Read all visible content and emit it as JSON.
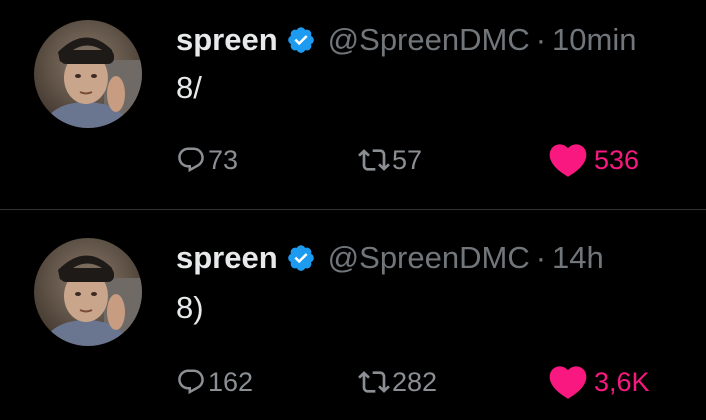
{
  "colors": {
    "background": "#000000",
    "text": "#e7e9ea",
    "muted": "#71767b",
    "verified": "#1d9bf0",
    "like": "#f91880",
    "divider": "#2f3336"
  },
  "tweets": [
    {
      "display_name": "spreen",
      "handle": "@SpreenDMC",
      "separator": "·",
      "time": "10min",
      "text": "8/",
      "replies": "73",
      "retweets": "57",
      "likes": "536",
      "liked": true
    },
    {
      "display_name": "spreen",
      "handle": "@SpreenDMC",
      "separator": "·",
      "time": "14h",
      "text": "8)",
      "replies": "162",
      "retweets": "282",
      "likes": "3,6K",
      "liked": true
    }
  ]
}
